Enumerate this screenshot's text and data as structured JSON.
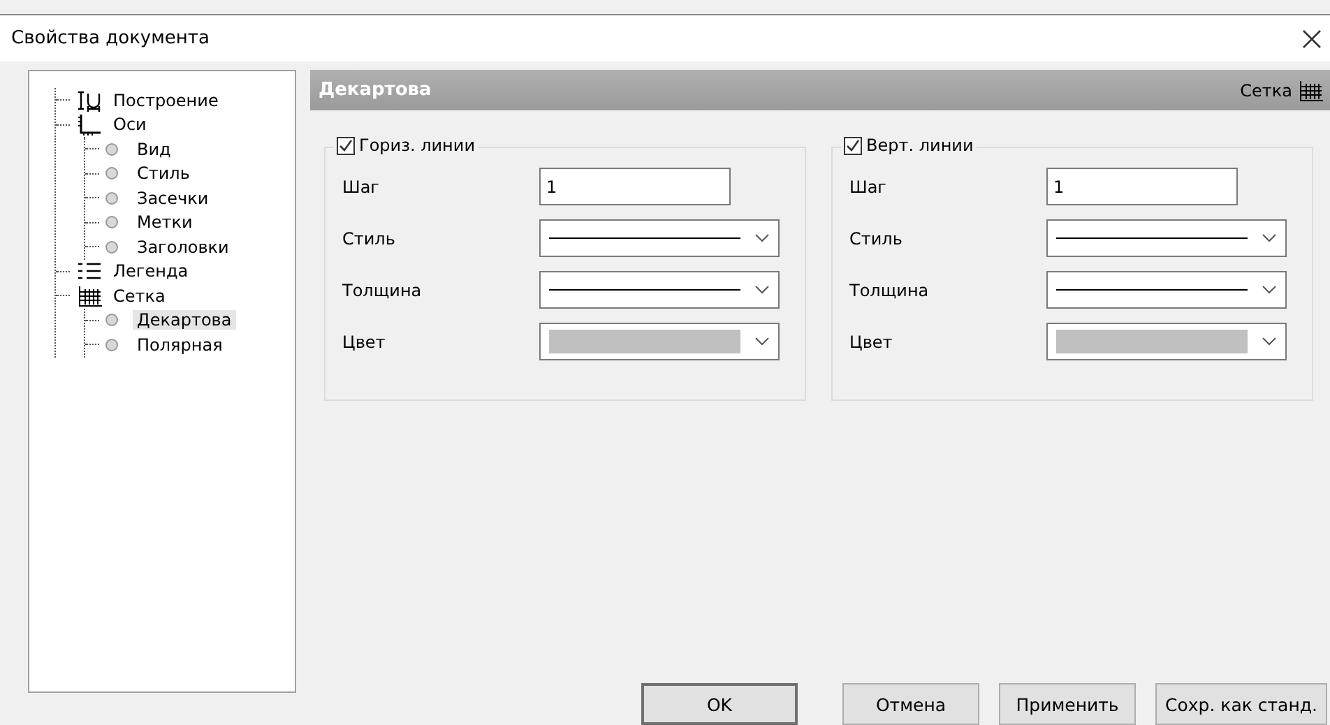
{
  "window": {
    "title": "Свойства документа"
  },
  "tree": [
    {
      "label": "Построение",
      "kind": "build",
      "selected": false
    },
    {
      "label": "Оси",
      "kind": "axes",
      "selected": false,
      "children": [
        {
          "label": "Вид",
          "kind": "bullet",
          "selected": false
        },
        {
          "label": "Стиль",
          "kind": "bullet",
          "selected": false
        },
        {
          "label": "Засечки",
          "kind": "bullet",
          "selected": false
        },
        {
          "label": "Метки",
          "kind": "bullet",
          "selected": false
        },
        {
          "label": "Заголовки",
          "kind": "bullet",
          "selected": false
        }
      ]
    },
    {
      "label": "Легенда",
      "kind": "legend",
      "selected": false
    },
    {
      "label": "Сетка",
      "kind": "grid",
      "selected": false,
      "children": [
        {
          "label": "Декартова",
          "kind": "bullet",
          "selected": true
        },
        {
          "label": "Полярная",
          "kind": "bullet",
          "selected": false
        }
      ]
    }
  ],
  "panel": {
    "title": "Декартова",
    "section": "Сетка"
  },
  "groups": [
    {
      "title": "Гориз. линии",
      "checked": true,
      "fields": [
        {
          "kind": "text",
          "label": "Шаг",
          "value": "1"
        },
        {
          "kind": "line",
          "label": "Стиль"
        },
        {
          "kind": "line",
          "label": "Толщина"
        },
        {
          "kind": "color",
          "label": "Цвет",
          "color": "#c0c0c0"
        }
      ]
    },
    {
      "title": "Верт. линии",
      "checked": true,
      "fields": [
        {
          "kind": "text",
          "label": "Шаг",
          "value": "1"
        },
        {
          "kind": "line",
          "label": "Стиль"
        },
        {
          "kind": "line",
          "label": "Толщина"
        },
        {
          "kind": "color",
          "label": "Цвет",
          "color": "#c0c0c0"
        }
      ]
    }
  ],
  "buttons": [
    {
      "label": "OK",
      "default": true
    },
    {
      "label": "Отмена",
      "default": false
    },
    {
      "label": "Применить",
      "default": false
    },
    {
      "label": "Сохр. как станд.",
      "default": false
    }
  ]
}
